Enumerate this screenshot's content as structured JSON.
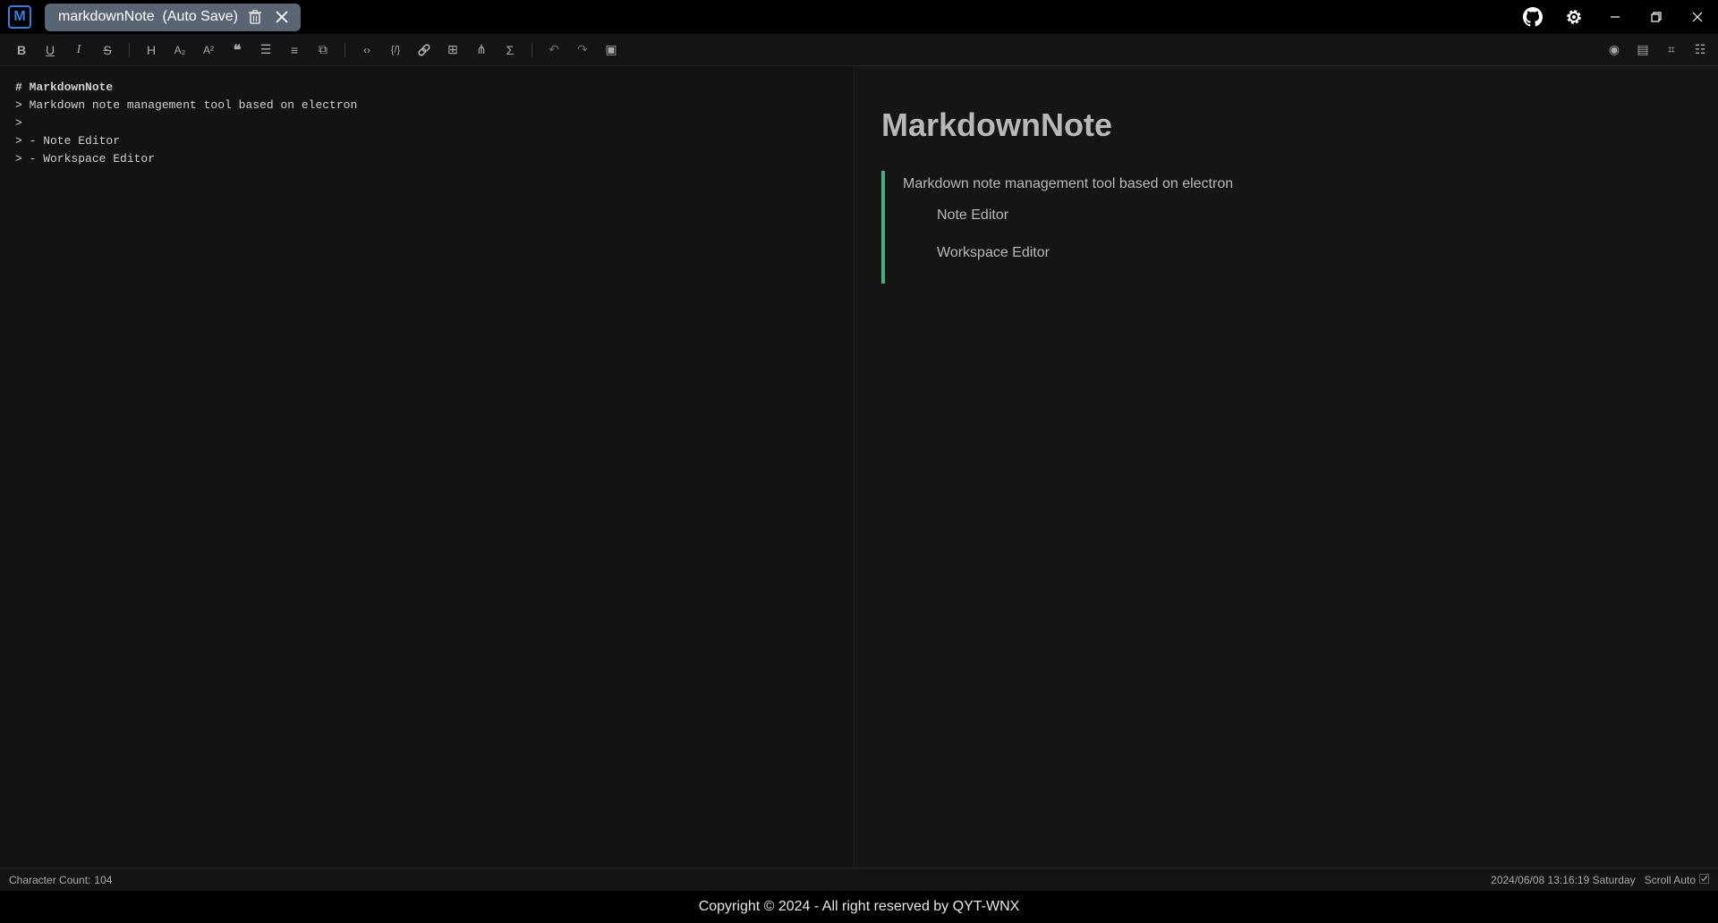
{
  "app": {
    "logo_letter": "M",
    "accent": "#3b7ddd"
  },
  "tab": {
    "title": "markdownNote  (Auto Save)",
    "delete_icon": "trash-icon",
    "close_icon": "close-icon"
  },
  "window_controls": [
    "github-icon",
    "gear-icon",
    "minimize-icon",
    "restore-icon",
    "close-icon"
  ],
  "toolbar": {
    "left": [
      {
        "name": "bold",
        "glyph": "B"
      },
      {
        "name": "underline",
        "glyph": "U"
      },
      {
        "name": "italic",
        "glyph": "I"
      },
      {
        "name": "strikethrough",
        "glyph": "S"
      },
      {
        "name": "heading",
        "glyph": "H"
      },
      {
        "name": "subscript",
        "glyph": "A₂"
      },
      {
        "name": "superscript",
        "glyph": "A²"
      },
      {
        "name": "quote",
        "glyph": "❝"
      },
      {
        "name": "unordered-list",
        "glyph": "☰"
      },
      {
        "name": "ordered-list",
        "glyph": "≡"
      },
      {
        "name": "task-list",
        "glyph": "⧉"
      },
      {
        "name": "code-inline",
        "glyph": "‹›"
      },
      {
        "name": "code-block",
        "glyph": "{/}"
      },
      {
        "name": "link",
        "glyph": "🔗"
      },
      {
        "name": "table",
        "glyph": "⊞"
      },
      {
        "name": "mermaid",
        "glyph": "⋔"
      },
      {
        "name": "katex",
        "glyph": "Σ"
      },
      {
        "name": "undo",
        "glyph": "↶"
      },
      {
        "name": "redo",
        "glyph": "↷"
      },
      {
        "name": "save",
        "glyph": "▣"
      }
    ],
    "right": [
      {
        "name": "preview",
        "glyph": "◉"
      },
      {
        "name": "preview-only",
        "glyph": "▤"
      },
      {
        "name": "html-preview",
        "glyph": "⌗"
      },
      {
        "name": "catalog",
        "glyph": "☷"
      }
    ]
  },
  "editor": {
    "lines": [
      "# MarkdownNote",
      "> Markdown note management tool based on electron",
      ">",
      "> - Note Editor",
      "> - Workspace Editor"
    ]
  },
  "preview": {
    "title": "MarkdownNote",
    "quote_text": "Markdown note management tool based on electron",
    "list": [
      "Note Editor",
      "Workspace Editor"
    ],
    "quote_color": "#3fb27f"
  },
  "status": {
    "char_count_label": "Character Count:",
    "char_count": "104",
    "datetime": "2024/06/08 13:16:19 Saturday",
    "scroll_label": "Scroll Auto"
  },
  "footer": {
    "text": "Copyright © 2024 - All right reserved by QYT-WNX"
  }
}
